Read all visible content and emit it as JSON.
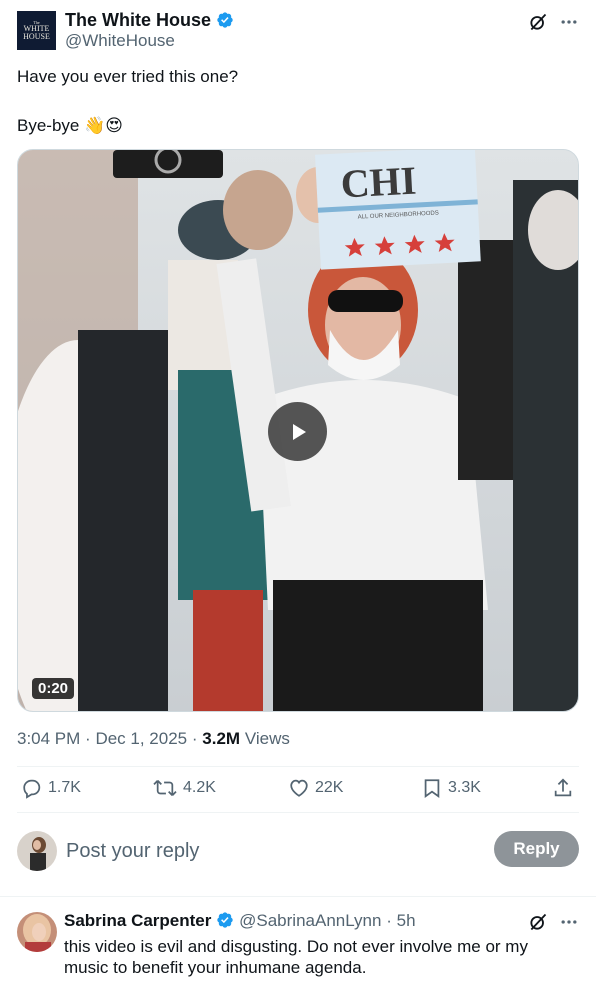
{
  "tweet": {
    "author_name": "The White House",
    "author_handle": "@WhiteHouse",
    "avatar_text_small": "The",
    "avatar_text_line1": "WHITE",
    "avatar_text_line2": "HOUSE",
    "line1": "Have you ever tried this one?",
    "line2": "Bye-bye 👋😍",
    "video_duration": "0:20",
    "video_sign_text": "CHI",
    "video_sign_subtext": "ALL OUR NEIGHBORHOODS",
    "time": "3:04 PM",
    "sep1": "·",
    "date": "Dec 1, 2025",
    "sep2": "·",
    "views_count": "3.2M",
    "views_label": "Views"
  },
  "actions": {
    "replies": "1.7K",
    "reposts": "4.2K",
    "likes": "22K",
    "bookmarks": "3.3K"
  },
  "composer": {
    "placeholder": "Post your reply",
    "button": "Reply"
  },
  "reply": {
    "name": "Sabrina Carpenter",
    "handle": "@SabrinaAnnLynn",
    "sep": "·",
    "time": "5h",
    "text": "this video is evil and disgusting. Do not ever involve me or my music to benefit your inhumane agenda."
  },
  "colors": {
    "text": "#0f1419",
    "secondary": "#536471",
    "verified": "#1d9bf0",
    "reply_button": "#8e9499"
  },
  "icons": [
    "verified-badge-icon",
    "grok-icon",
    "more-icon",
    "play-icon",
    "reply-icon",
    "repost-icon",
    "like-icon",
    "bookmark-icon",
    "share-icon"
  ]
}
